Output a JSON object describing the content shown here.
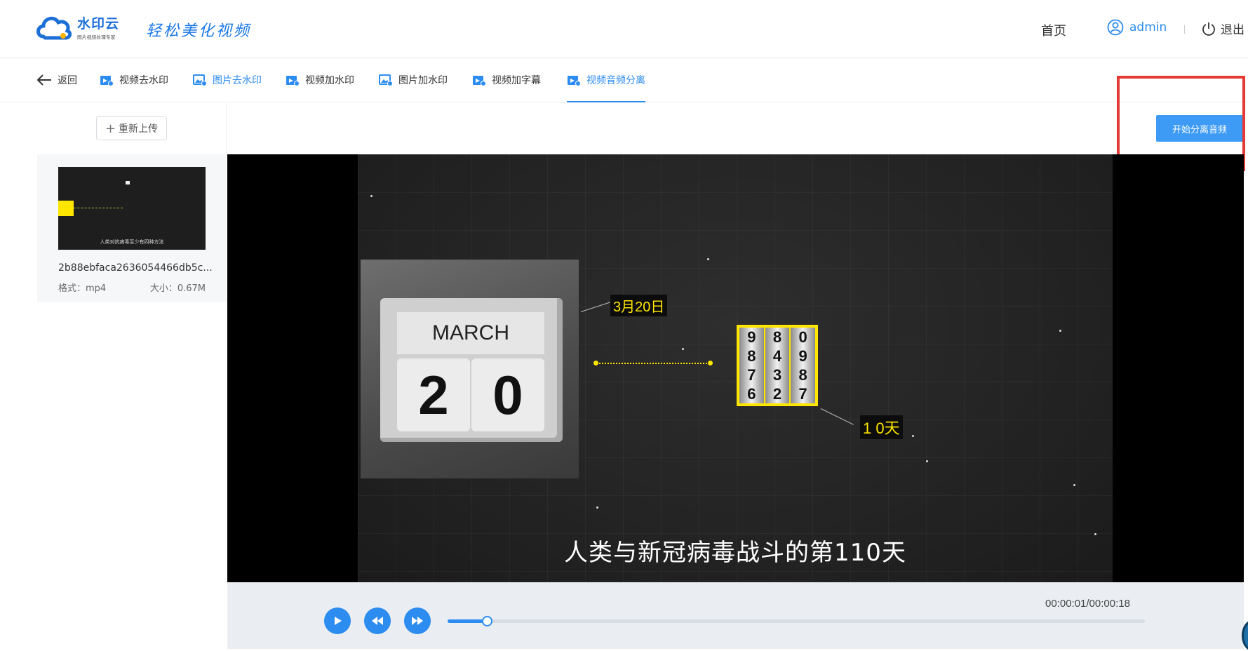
{
  "header": {
    "logo_title": "水印云",
    "logo_subtitle": "图片视频处理专家",
    "slogan": "轻松美化视频",
    "home": "首页",
    "username": "admin",
    "logout": "退出"
  },
  "tabs": [
    {
      "label": "返回"
    },
    {
      "label": "视频去水印"
    },
    {
      "label": "图片去水印"
    },
    {
      "label": "视频加水印"
    },
    {
      "label": "图片加水印"
    },
    {
      "label": "视频加字幕"
    },
    {
      "label": "视频音频分离"
    }
  ],
  "sidebar": {
    "reupload_label": "重新上传",
    "file": {
      "name": "2b88ebfaca2636054466db5c...",
      "format": "格式：mp4",
      "size": "大小：0.67M",
      "thumb_caption": "人类对抗病毒至少有四种方法"
    }
  },
  "actions": {
    "start_label": "开始分离音频"
  },
  "video": {
    "calendar_month": "MARCH",
    "calendar_digit_1": "2",
    "calendar_digit_2": "0",
    "date_label": "3月20日",
    "days_label": "1 0天",
    "counter_wheels": [
      [
        "9",
        "8",
        "7",
        "6"
      ],
      [
        "8",
        "4",
        "3",
        "2"
      ],
      [
        "0",
        "9",
        "8",
        "7"
      ]
    ],
    "subtitle": "人类与新冠病毒战斗的第110天"
  },
  "player": {
    "timecode": "00:00:01/00:00:18",
    "progress": 0.056
  },
  "colors": {
    "accent": "#2d8cf0",
    "highlight": "#e53935",
    "label_yellow": "#ffe600"
  }
}
